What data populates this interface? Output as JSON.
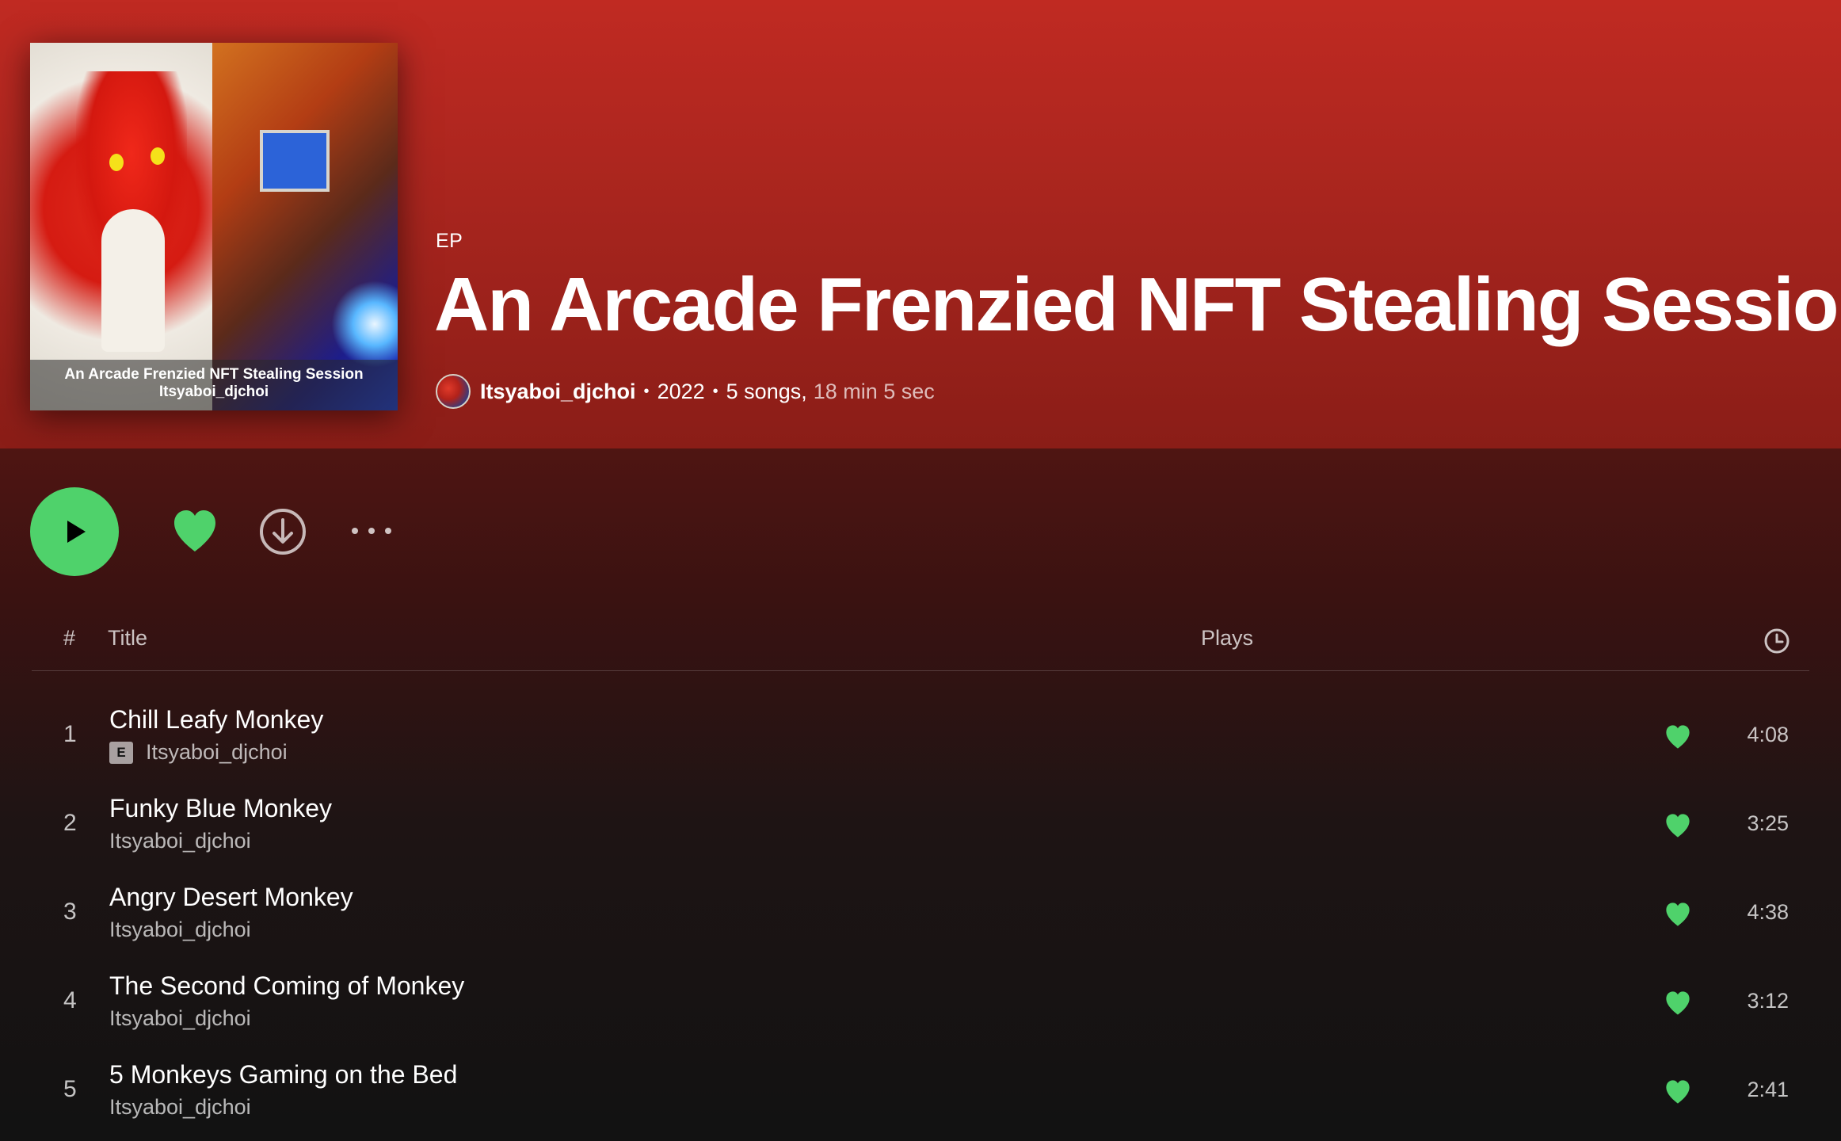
{
  "album": {
    "type_label": "EP",
    "title": "An Arcade Frenzied NFT Stealing Session",
    "artist": "Itsyaboi_djchoi",
    "year": "2022",
    "song_count": "5 songs,",
    "duration": "18 min 5 sec",
    "cover_caption_line1": "An Arcade Frenzied NFT Stealing Session",
    "cover_caption_line2": "Itsyaboi_djchoi"
  },
  "colors": {
    "header_red": "#c02a22",
    "accent_green": "#1ed760",
    "background": "#121212"
  },
  "controls": {
    "play_icon": "play-icon",
    "like_icon": "heart-filled-icon",
    "download_icon": "download-icon",
    "more_icon": "more-horizontal-icon"
  },
  "table": {
    "header_num": "#",
    "header_title": "Title",
    "header_plays": "Plays",
    "header_duration_icon": "clock-icon"
  },
  "tracks": [
    {
      "num": "1",
      "title": "Chill Leafy Monkey",
      "artist": "Itsyaboi_djchoi",
      "explicit": "E",
      "duration": "4:08"
    },
    {
      "num": "2",
      "title": "Funky Blue Monkey",
      "artist": "Itsyaboi_djchoi",
      "explicit": "",
      "duration": "3:25"
    },
    {
      "num": "3",
      "title": "Angry Desert Monkey",
      "artist": "Itsyaboi_djchoi",
      "explicit": "",
      "duration": "4:38"
    },
    {
      "num": "4",
      "title": "The Second Coming of Monkey",
      "artist": "Itsyaboi_djchoi",
      "explicit": "",
      "duration": "3:12"
    },
    {
      "num": "5",
      "title": "5 Monkeys Gaming on the Bed",
      "artist": "Itsyaboi_djchoi",
      "explicit": "",
      "duration": "2:41"
    }
  ]
}
